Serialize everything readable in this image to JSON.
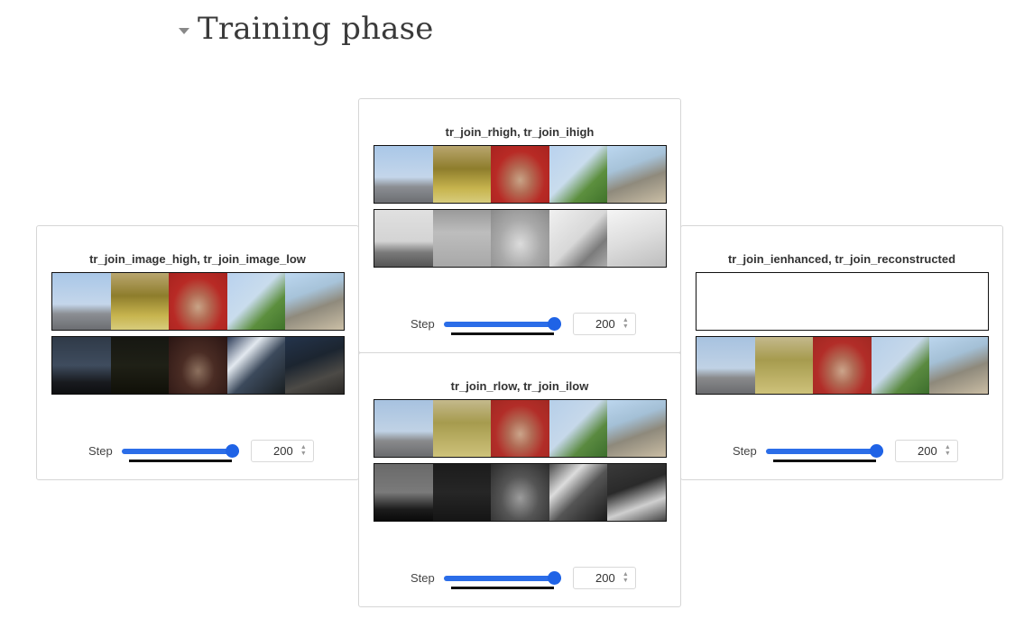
{
  "section": {
    "title": "Training phase"
  },
  "panels": {
    "left": {
      "title": "tr_join_image_high, tr_join_image_low",
      "strips": [
        {
          "kind": "color",
          "tiles": [
            "obelisk-square",
            "colorful-room",
            "red-throne-statue",
            "green-cliff",
            "rocky-slope"
          ]
        },
        {
          "kind": "dark",
          "tiles": [
            "obelisk-square",
            "colorful-room",
            "red-throne-statue",
            "green-cliff",
            "rocky-slope"
          ]
        }
      ],
      "step": {
        "label": "Step",
        "value": "200",
        "slider_fraction": 1.0
      }
    },
    "top": {
      "title": "tr_join_rhigh, tr_join_ihigh",
      "strips": [
        {
          "kind": "color",
          "tiles": [
            "obelisk-square",
            "colorful-room",
            "red-throne-statue",
            "green-cliff",
            "rocky-slope"
          ]
        },
        {
          "kind": "grayscale",
          "tiles": [
            "obelisk-square",
            "colorful-room",
            "red-throne-statue",
            "green-cliff",
            "rocky-slope"
          ]
        }
      ],
      "step": {
        "label": "Step",
        "value": "200",
        "slider_fraction": 1.0
      }
    },
    "bottom": {
      "title": "tr_join_rlow, tr_join_ilow",
      "strips": [
        {
          "kind": "color",
          "tiles": [
            "obelisk-square",
            "colorful-room",
            "red-throne-statue",
            "green-cliff",
            "rocky-slope"
          ]
        },
        {
          "kind": "dark-grayscale",
          "tiles": [
            "obelisk-square",
            "colorful-room",
            "red-throne-statue",
            "green-cliff",
            "rocky-slope"
          ]
        }
      ],
      "step": {
        "label": "Step",
        "value": "200",
        "slider_fraction": 1.0
      }
    },
    "right": {
      "title": "tr_join_ienhanced, tr_join_reconstructed",
      "strips": [
        {
          "kind": "empty",
          "tiles": []
        },
        {
          "kind": "color",
          "tiles": [
            "obelisk-square",
            "colorful-room",
            "red-throne-statue",
            "green-cliff",
            "rocky-slope"
          ]
        }
      ],
      "step": {
        "label": "Step",
        "value": "200",
        "slider_fraction": 1.0
      }
    }
  },
  "colors": {
    "slider_accent": "#2b6de8",
    "panel_border": "#d6d6d6"
  },
  "icons": {
    "collapse": "caret-down-icon",
    "spinner": "spinner-arrows-icon"
  }
}
